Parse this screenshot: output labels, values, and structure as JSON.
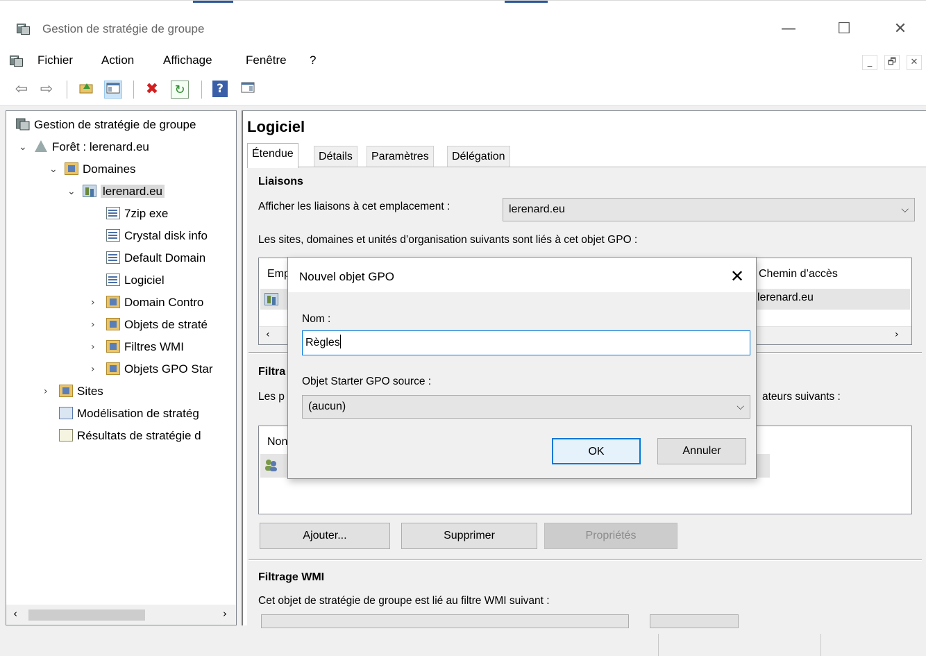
{
  "window": {
    "title": "Gestion de stratégie de groupe",
    "controls": {
      "minimize": "—",
      "maximize": "☐",
      "close": "✕"
    }
  },
  "menubar": {
    "items": [
      "Fichier",
      "Action",
      "Affichage",
      "Fenêtre",
      "?"
    ],
    "mdi": {
      "minimize": "_",
      "restore": "🗗",
      "close": "✕"
    }
  },
  "toolbar": {
    "icons": [
      "back-arrow-icon",
      "forward-arrow-icon",
      "up-folder-icon",
      "show-hide-tree-icon",
      "delete-icon",
      "refresh-icon",
      "help-icon",
      "properties-pane-icon"
    ],
    "glyphs": {
      "back": "⇦",
      "forward": "⇨",
      "delete": "✖",
      "refresh": "↻",
      "help": "?"
    }
  },
  "tree": {
    "items": [
      {
        "label": "Gestion de stratégie de groupe",
        "icon": "gpmc-icon"
      },
      {
        "label": "Forêt : lerenard.eu",
        "icon": "forest-icon",
        "expander": "⌄"
      },
      {
        "label": "Domaines",
        "icon": "domains-folder-icon",
        "expander": "⌄"
      },
      {
        "label": "lerenard.eu",
        "icon": "domain-icon",
        "expander": "⌄",
        "selected": true
      },
      {
        "label": "7zip exe",
        "icon": "gpo-link-icon"
      },
      {
        "label": "Crystal disk info",
        "icon": "gpo-link-icon"
      },
      {
        "label": "Default Domain",
        "icon": "gpo-link-icon"
      },
      {
        "label": "Logiciel",
        "icon": "gpo-link-icon"
      },
      {
        "label": "Domain Contro",
        "icon": "ou-folder-icon",
        "expander": "›"
      },
      {
        "label": "Objets de straté",
        "icon": "gpo-folder-icon",
        "expander": "›"
      },
      {
        "label": "Filtres WMI",
        "icon": "wmi-folder-icon",
        "expander": "›"
      },
      {
        "label": "Objets GPO Star",
        "icon": "starter-gpo-folder-icon",
        "expander": "›"
      },
      {
        "label": "Sites",
        "icon": "sites-folder-icon",
        "expander": "›"
      },
      {
        "label": "Modélisation de stratég",
        "icon": "modeling-icon"
      },
      {
        "label": "Résultats de stratégie d",
        "icon": "results-icon"
      }
    ],
    "scroll": {
      "left": "‹",
      "right": "›"
    }
  },
  "details": {
    "title": "Logiciel",
    "tabs": [
      "Étendue",
      "Détails",
      "Paramètres",
      "Délégation"
    ],
    "links": {
      "heading": "Liaisons",
      "show_label": "Afficher les liaisons à cet emplacement :",
      "location_value": "lerenard.eu",
      "description": "Les sites, domaines et unités d’organisation suivants sont liés à cet objet GPO :",
      "col_location": "Emp",
      "col_path": "Chemin d’accès",
      "row_path": "lerenard.eu"
    },
    "security": {
      "heading": "Filtra",
      "description_start": "Les p",
      "description_end": "ateurs suivants :",
      "col_name": "Non"
    },
    "buttons": {
      "add": "Ajouter...",
      "remove": "Supprimer",
      "properties": "Propriétés"
    },
    "wmi": {
      "heading": "Filtrage WMI",
      "description": "Cet objet de stratégie de groupe est lié au filtre WMI suivant :"
    }
  },
  "dialog": {
    "title": "Nouvel objet GPO",
    "close": "✕",
    "name_label": "Nom :",
    "name_value": "Règles",
    "source_label": "Objet Starter GPO source :",
    "source_value": "(aucun)",
    "ok": "OK",
    "cancel": "Annuler"
  },
  "colors": {
    "accent": "#0078d7",
    "selection": "#d9d9d9",
    "dialog_bg": "#f0f0f0"
  }
}
